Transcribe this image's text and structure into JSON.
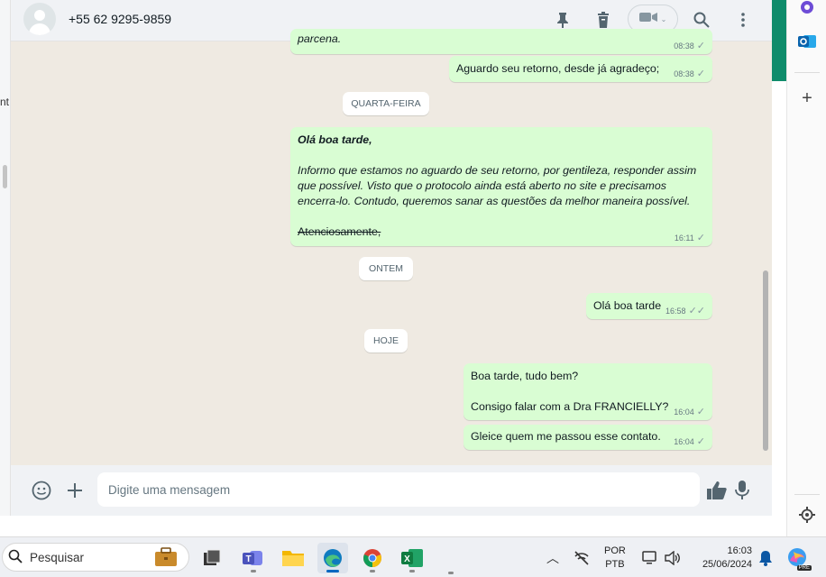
{
  "left_strip": {
    "partial_text": "nt"
  },
  "header": {
    "contact_name": "+55 62 9295-9859"
  },
  "messages": [
    {
      "id": "m0",
      "text_partial": "parcena.",
      "time": "08:38"
    },
    {
      "id": "m1",
      "text": "Aguardo seu retorno, desde já agradeço;",
      "time": "08:38"
    },
    {
      "id": "d1",
      "date": "QUARTA-FEIRA"
    },
    {
      "id": "m2",
      "bold_line": "Olá boa tarde,",
      "body": "Informo que estamos no aguardo de seu retorno, por gentileza, responder assim que possível. Visto que o protocolo ainda está aberto no site e precisamos encerra-lo. Contudo, queremos sanar as questões da melhor maneira possível.",
      "strike_line": "Atenciosamente,",
      "time": "16:11"
    },
    {
      "id": "d2",
      "date": "ONTEM"
    },
    {
      "id": "m3",
      "text": "Olá boa tarde",
      "time": "16:58"
    },
    {
      "id": "d3",
      "date": "HOJE"
    },
    {
      "id": "m4",
      "line1": "Boa tarde, tudo bem?",
      "line2": "Consigo falar com a Dra FRANCIELLY?",
      "time": "16:04"
    },
    {
      "id": "m5",
      "text": "Gleice quem me passou esse contato.",
      "time": "16:04"
    }
  ],
  "composer": {
    "placeholder": "Digite uma mensagem"
  },
  "taskbar": {
    "search_label": "Pesquisar",
    "lang_top": "POR",
    "lang_bottom": "PTB",
    "time": "16:03",
    "date": "25/06/2024",
    "copilot_badge": "PRE"
  },
  "colors": {
    "outgoing_bubble": "#d9fdd3",
    "chat_background": "#efeae2",
    "header_background": "#f0f2f5",
    "green_bar": "#0f8c6b"
  },
  "icons": [
    "pin-icon",
    "trash-icon",
    "video-call-icon",
    "search-icon",
    "more-options-icon",
    "emoji-icon",
    "attach-plus-icon",
    "thumbs-up-icon",
    "microphone-icon",
    "double-check-icon",
    "single-check-icon"
  ]
}
